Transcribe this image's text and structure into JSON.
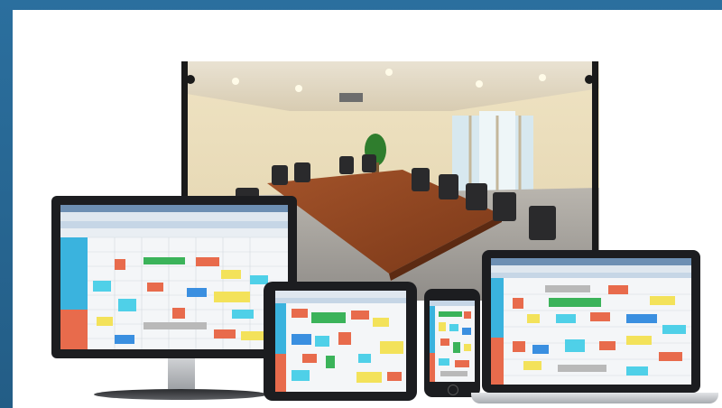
{
  "scene": {
    "description_alt": "",
    "colors": {
      "frame_blue": "#2b6f9e",
      "event_red": "#e86b4c",
      "event_green": "#3bb35a",
      "event_yellow": "#f3e25a",
      "event_cyan": "#4fd0e8",
      "event_blue": "#3a8fe0",
      "event_gray": "#b9b9b9"
    }
  }
}
